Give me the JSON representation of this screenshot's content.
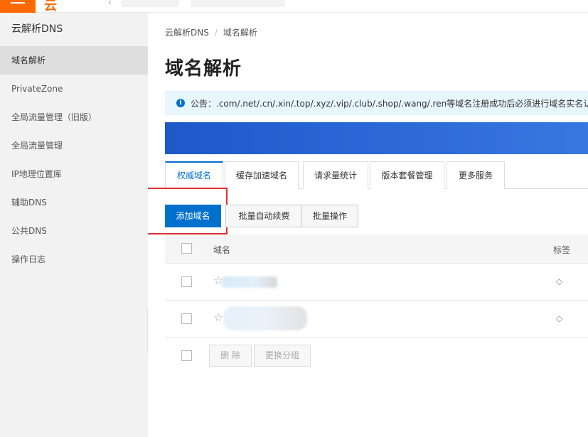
{
  "topbar": {
    "menu_icon": "menu-icon",
    "logo_text": "云",
    "brand_color": "#ff6a00"
  },
  "sidebar": {
    "title": "云解析DNS",
    "items": [
      {
        "label": "域名解析",
        "active": true
      },
      {
        "label": "PrivateZone"
      },
      {
        "label": "全局流量管理（旧版）"
      },
      {
        "label": "全局流量管理"
      },
      {
        "label": "IP地理位置库"
      },
      {
        "label": "辅助DNS"
      },
      {
        "label": "公共DNS"
      },
      {
        "label": "操作日志"
      }
    ],
    "collapse_icon": "chevron-left-icon"
  },
  "main": {
    "breadcrumb": [
      "云解析DNS",
      "/",
      "域名解析"
    ],
    "page_title": "域名解析",
    "notice": {
      "icon": "info-icon",
      "text": "公告：.com/.net/.cn/.xin/.top/.xyz/.vip/.club/.shop/.wang/.ren等域名注册成功后必须进行域名实名认证，否"
    },
    "tabs": [
      {
        "label": "权威域名",
        "active": true
      },
      {
        "label": "缓存加速域名"
      },
      {
        "label": "请求量统计"
      },
      {
        "label": "版本套餐管理"
      },
      {
        "label": "更多服务"
      }
    ],
    "actions": {
      "add_domain": "添加域名",
      "batch_renew": "批量自动续费",
      "batch_ops": "批量操作"
    },
    "table": {
      "columns": [
        "域名",
        "标签"
      ],
      "rows": [
        {
          "star_icon": "star-icon",
          "tag_icon": "tag-icon"
        },
        {
          "star_icon": "star-icon",
          "tag_icon": "tag-icon"
        }
      ],
      "footer": {
        "delete": "删 除",
        "change_group": "更换分组"
      }
    }
  },
  "colors": {
    "accent": "#0070cc",
    "highlight_box": "#e03131",
    "notice_bg": "#e8f6fd",
    "banner": "#2d6ad8"
  }
}
